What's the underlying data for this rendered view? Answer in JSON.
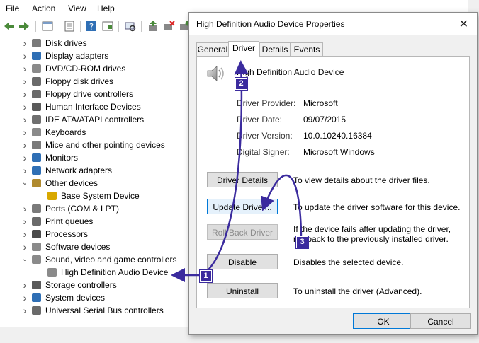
{
  "menubar": {
    "items": [
      "File",
      "Action",
      "View",
      "Help"
    ]
  },
  "tree": {
    "items": [
      {
        "label": "Disk drives",
        "expanded": false,
        "icon": "disk-drive-icon",
        "color": "#7a7a7a"
      },
      {
        "label": "Display adapters",
        "expanded": false,
        "icon": "display-adapter-icon",
        "color": "#2f6fb5"
      },
      {
        "label": "DVD/CD-ROM drives",
        "expanded": false,
        "icon": "dvd-drive-icon",
        "color": "#8a8a8a"
      },
      {
        "label": "Floppy disk drives",
        "expanded": false,
        "icon": "floppy-disk-icon",
        "color": "#6a6a6a"
      },
      {
        "label": "Floppy drive controllers",
        "expanded": false,
        "icon": "floppy-controller-icon",
        "color": "#6a6a6a"
      },
      {
        "label": "Human Interface Devices",
        "expanded": false,
        "icon": "hid-icon",
        "color": "#5a5a5a"
      },
      {
        "label": "IDE ATA/ATAPI controllers",
        "expanded": false,
        "icon": "ide-controller-icon",
        "color": "#6f6f6f"
      },
      {
        "label": "Keyboards",
        "expanded": false,
        "icon": "keyboard-icon",
        "color": "#8a8a8a"
      },
      {
        "label": "Mice and other pointing devices",
        "expanded": false,
        "icon": "mouse-icon",
        "color": "#7a7a7a"
      },
      {
        "label": "Monitors",
        "expanded": false,
        "icon": "monitor-icon",
        "color": "#2f6fb5"
      },
      {
        "label": "Network adapters",
        "expanded": false,
        "icon": "network-adapter-icon",
        "color": "#2f6fb5"
      },
      {
        "label": "Other devices",
        "expanded": true,
        "icon": "other-devices-icon",
        "color": "#b08a2e"
      },
      {
        "label": "Base System Device",
        "child": true,
        "icon": "warning-device-icon",
        "color": "#d8a800"
      },
      {
        "label": "Ports (COM & LPT)",
        "expanded": false,
        "icon": "port-icon",
        "color": "#7a7a7a"
      },
      {
        "label": "Print queues",
        "expanded": false,
        "icon": "printer-icon",
        "color": "#6a6a6a"
      },
      {
        "label": "Processors",
        "expanded": false,
        "icon": "processor-icon",
        "color": "#4a4a4a"
      },
      {
        "label": "Software devices",
        "expanded": false,
        "icon": "software-device-icon",
        "color": "#8a8a8a"
      },
      {
        "label": "Sound, video and game controllers",
        "expanded": true,
        "icon": "speaker-icon",
        "color": "#8a8a8a"
      },
      {
        "label": "High Definition Audio Device",
        "child": true,
        "icon": "speaker-icon",
        "color": "#8a8a8a"
      },
      {
        "label": "Storage controllers",
        "expanded": false,
        "icon": "storage-controller-icon",
        "color": "#5a5a5a"
      },
      {
        "label": "System devices",
        "expanded": false,
        "icon": "system-device-icon",
        "color": "#2f6fb5"
      },
      {
        "label": "Universal Serial Bus controllers",
        "expanded": false,
        "icon": "usb-icon",
        "color": "#6a6a6a"
      }
    ]
  },
  "dialog": {
    "title": "High Definition Audio Device Properties",
    "tabs": [
      "General",
      "Driver",
      "Details",
      "Events"
    ],
    "active_tab": "Driver",
    "device_name": "High Definition Audio Device",
    "props": [
      {
        "label": "Driver Provider:",
        "value": "Microsoft"
      },
      {
        "label": "Driver Date:",
        "value": "09/07/2015"
      },
      {
        "label": "Driver Version:",
        "value": "10.0.10240.16384"
      },
      {
        "label": "Digital Signer:",
        "value": "Microsoft Windows"
      }
    ],
    "actions": [
      {
        "button": "Driver Details",
        "description": "To view details about the driver files.",
        "enabled": true
      },
      {
        "button": "Update Driver...",
        "description": "To update the driver software for this device.",
        "enabled": true,
        "focused": true
      },
      {
        "button": "Roll Back Driver",
        "description": "If the device fails after updating the driver, roll back to the previously installed driver.",
        "enabled": false
      },
      {
        "button": "Disable",
        "description": "Disables the selected device.",
        "enabled": true
      },
      {
        "button": "Uninstall",
        "description": "To uninstall the driver (Advanced).",
        "enabled": true
      }
    ],
    "ok_label": "OK",
    "cancel_label": "Cancel"
  },
  "annotations": [
    "1",
    "2",
    "3"
  ],
  "colors": {
    "annotation": "#3b2b9e",
    "focus": "#0078d7"
  }
}
